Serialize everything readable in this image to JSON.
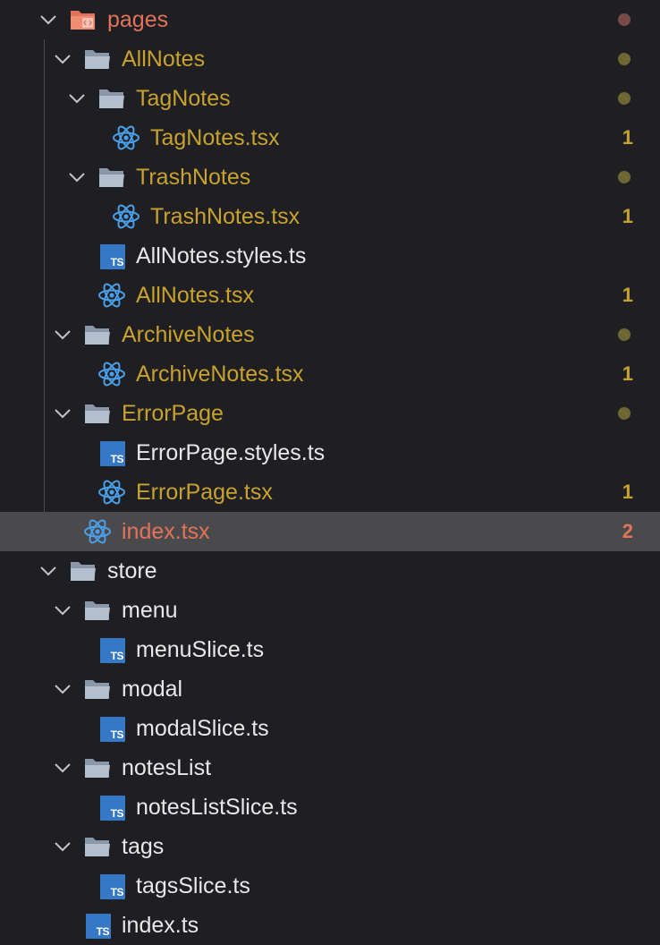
{
  "colors": {
    "modified": "#c8a22e",
    "error": "#e2735b",
    "normal": "#e8e8e8",
    "dot_modified": "#6d6733",
    "dot_error": "#7a4a46",
    "badge_modified": "#c8a22e",
    "badge_error": "#e2735b"
  },
  "items": [
    {
      "label": "pages",
      "kind": "folder-special",
      "depth": 0,
      "expanded": true,
      "status": "error",
      "dot": true
    },
    {
      "label": "AllNotes",
      "kind": "folder",
      "depth": 1,
      "expanded": true,
      "status": "modified",
      "dot": true
    },
    {
      "label": "TagNotes",
      "kind": "folder",
      "depth": 2,
      "expanded": true,
      "status": "modified",
      "dot": true
    },
    {
      "label": "TagNotes.tsx",
      "kind": "react",
      "depth": 3,
      "status": "modified",
      "badge": "1"
    },
    {
      "label": "TrashNotes",
      "kind": "folder",
      "depth": 2,
      "expanded": true,
      "status": "modified",
      "dot": true
    },
    {
      "label": "TrashNotes.tsx",
      "kind": "react",
      "depth": 3,
      "status": "modified",
      "badge": "1"
    },
    {
      "label": "AllNotes.styles.ts",
      "kind": "ts",
      "depth": 2,
      "status": "normal"
    },
    {
      "label": "AllNotes.tsx",
      "kind": "react",
      "depth": 2,
      "status": "modified",
      "badge": "1"
    },
    {
      "label": "ArchiveNotes",
      "kind": "folder",
      "depth": 1,
      "expanded": true,
      "status": "modified",
      "dot": true
    },
    {
      "label": "ArchiveNotes.tsx",
      "kind": "react",
      "depth": 2,
      "status": "modified",
      "badge": "1"
    },
    {
      "label": "ErrorPage",
      "kind": "folder",
      "depth": 1,
      "expanded": true,
      "status": "modified",
      "dot": true
    },
    {
      "label": "ErrorPage.styles.ts",
      "kind": "ts",
      "depth": 2,
      "status": "normal"
    },
    {
      "label": "ErrorPage.tsx",
      "kind": "react",
      "depth": 2,
      "status": "modified",
      "badge": "1"
    },
    {
      "label": "index.tsx",
      "kind": "react",
      "depth": 1,
      "status": "error",
      "badge": "2",
      "selected": true
    },
    {
      "label": "store",
      "kind": "folder",
      "depth": 0,
      "expanded": true,
      "status": "normal"
    },
    {
      "label": "menu",
      "kind": "folder",
      "depth": 1,
      "expanded": true,
      "status": "normal"
    },
    {
      "label": "menuSlice.ts",
      "kind": "ts",
      "depth": 2,
      "status": "normal"
    },
    {
      "label": "modal",
      "kind": "folder",
      "depth": 1,
      "expanded": true,
      "status": "normal"
    },
    {
      "label": "modalSlice.ts",
      "kind": "ts",
      "depth": 2,
      "status": "normal"
    },
    {
      "label": "notesList",
      "kind": "folder",
      "depth": 1,
      "expanded": true,
      "status": "normal"
    },
    {
      "label": "notesListSlice.ts",
      "kind": "ts",
      "depth": 2,
      "status": "normal"
    },
    {
      "label": "tags",
      "kind": "folder",
      "depth": 1,
      "expanded": true,
      "status": "normal"
    },
    {
      "label": "tagsSlice.ts",
      "kind": "ts",
      "depth": 2,
      "status": "normal"
    },
    {
      "label": "index.ts",
      "kind": "ts",
      "depth": 1,
      "status": "normal"
    }
  ],
  "ts_icon_text": "TS"
}
